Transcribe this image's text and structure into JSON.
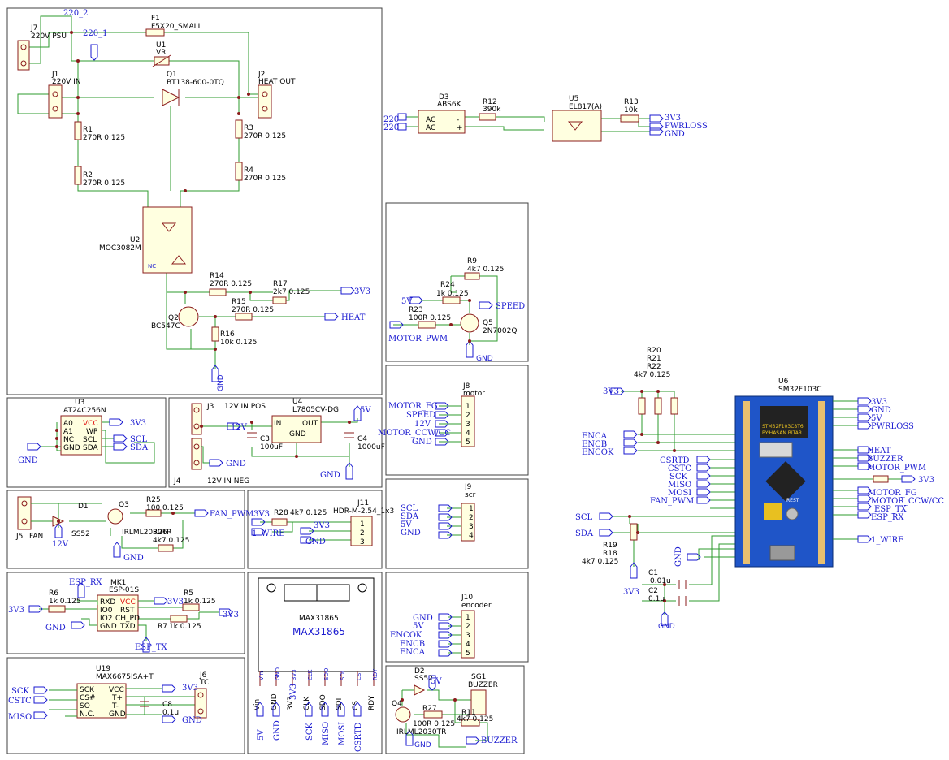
{
  "refs": {
    "j7": "J7",
    "j7v": "220V PSU",
    "n220_2": "220_2",
    "f1": "F1",
    "f1v": "F5X20_SMALL",
    "n220_1": "220_1",
    "u1": "U1",
    "u1v": "VR",
    "j1": "J1",
    "j1v": "220V IN",
    "q1": "Q1",
    "q1v": "BT138-600-0TQ",
    "j2": "J2",
    "j2v": "HEAT OUT",
    "r1": "R1",
    "r1v": "270R 0.125",
    "r2": "R2",
    "r2v": "270R 0.125",
    "r3": "R3",
    "r3v": "270R 0.125",
    "r4": "R4",
    "r4v": "270R 0.125",
    "u2": "U2",
    "u2v": "MOC3082M",
    "nc": "NC",
    "r14": "R14",
    "r14v": "270R 0.125",
    "r17": "R17",
    "r17v": "2k7 0.125",
    "r15": "R15",
    "r15v": "270R 0.125",
    "q2": "Q2",
    "q2v": "BC547C",
    "r16": "R16",
    "r16v": "10k 0.125",
    "d3": "D3",
    "d3v": "ABS6K",
    "r12": "R12",
    "r12v": "390k",
    "u5": "U5",
    "u5v": "EL817(A)",
    "r13": "R13",
    "r13v": "10k",
    "r9": "R9",
    "r9v": "4k7 0.125",
    "r24": "R24",
    "r24v": "1k 0.125",
    "r23": "R23",
    "r23v": "100R 0.125",
    "q5": "Q5",
    "q5v": "2N7002Q",
    "j8": "J8",
    "j8v": "motor",
    "j9": "J9",
    "j9v": "scr",
    "j10": "J10",
    "j10v": "encoder",
    "u3": "U3",
    "u3v": "AT24C256N",
    "u4": "U4",
    "u4v": "L7805CV-DG",
    "j3": "J3",
    "j3v": "12V IN POS",
    "j4": "J4",
    "j4v": "12V IN NEG",
    "c3": "C3",
    "c3v": "100uF",
    "c4": "C4",
    "c4v": "1000uF",
    "in": "IN",
    "out": "OUT",
    "gndtxt": "GND",
    "j5": "J5",
    "j5v": "FAN",
    "d1": "D1",
    "d1v": "SS52",
    "q3": "Q3",
    "q3v": "IRLML2030TR",
    "r25": "R25",
    "r25v": "100 0.125",
    "r26": "R26",
    "r26v": "4k7 0.125",
    "r28": "R28",
    "r28v": "4k7 0.125",
    "j11": "J11",
    "j11v": "HDR-M-2.54_1x3",
    "mk1": "MK1",
    "mk1v": "ESP-01S",
    "r6": "R6",
    "r6v": "1k 0.125",
    "r5": "R5",
    "r5v": "1k 0.125",
    "r7": "R7",
    "r7v": "1k 0.125",
    "u19": "U19",
    "u19v": "MAX6675ISA+T",
    "c8": "C8",
    "c8v": "0.1u",
    "j6": "J6",
    "j6v": "TC",
    "max1": "MAX31865",
    "max2": "MAX31865",
    "d2": "D2",
    "d2v": "SS52",
    "sg1": "SG1",
    "sg1v": "BUZZER",
    "q4": "Q4",
    "q4v": "IRLML2030TR",
    "r27": "R27",
    "r27v": "100R 0.125",
    "r11": "R11",
    "r11v": "4k7 0.125",
    "r20": "R20",
    "r21": "R21",
    "r22": "R22",
    "r2022v": "4k7 0.125",
    "u6": "U6",
    "u6v": "SM32F103C",
    "r19": "R19",
    "r18": "R18",
    "r1819v": "4k7 0.125",
    "c1": "C1",
    "c1v": "0.01u",
    "c2": "C2",
    "c2v": "0.1u",
    "chip1": "STM32F103C8T6",
    "chip2": "BY:HASAN BITAR",
    "rest": "REST"
  },
  "nets": {
    "v3": "3V3",
    "heat": "HEAT",
    "gnd": "GND",
    "pwrloss": "PWRLOSS",
    "n220": "220",
    "speed": "SPEED",
    "motor_pwm": "MOTOR_PWM",
    "v5": "5V",
    "v12": "12V",
    "fan_pwm": "FAN_PWM",
    "one_wire": "1_WIRE",
    "esp_rx": "ESP_RX",
    "esp_tx": "ESP_TX",
    "sck": "SCK",
    "cstc": "CSTC",
    "miso": "MISO",
    "mosi": "MOSI",
    "csrtd": "CSRTD",
    "scl": "SCL",
    "sda": "SDA",
    "motor_fg": "MOTOR_FG",
    "motor_ccw": "MOTOR_CCW/CC",
    "motor_ccw2": "MOTOR_CCW/CC",
    "enca": "ENCA",
    "encb": "ENCB",
    "encok": "ENCOK",
    "buzzer": "BUZZER",
    "motor_pwm2": "MOTOR_PWM"
  },
  "pins": {
    "u3_left": [
      "A0",
      "A1",
      "NC",
      "GND"
    ],
    "u3_right": [
      "VCC",
      "WP",
      "SCL",
      "SDA"
    ],
    "mk1_left": [
      "RXD",
      "IO0",
      "IO2",
      "GND"
    ],
    "mk1_right": [
      "VCC",
      "RST",
      "CH_PD",
      "TXD"
    ],
    "u19_left": [
      "SCK",
      "CS#",
      "SO",
      "N.C."
    ],
    "u19_right": [
      "VCC",
      "T+",
      "T-",
      "GND"
    ],
    "max_pins": [
      "Vin",
      "GND",
      "3V3",
      "CLK",
      "SDO",
      "SDI",
      "CS",
      "RDY"
    ],
    "max_nets": [
      "5V",
      "GND",
      "3V3",
      "SCK",
      "MISO",
      "MOSI",
      "CSRTD"
    ],
    "d3_pins": [
      "AC",
      "AC",
      "-",
      "+"
    ]
  },
  "colors": {
    "wire": "#2e9b2e",
    "component": "#8b1c1c",
    "net": "#1a1ad0",
    "board": "#1f55c8"
  }
}
